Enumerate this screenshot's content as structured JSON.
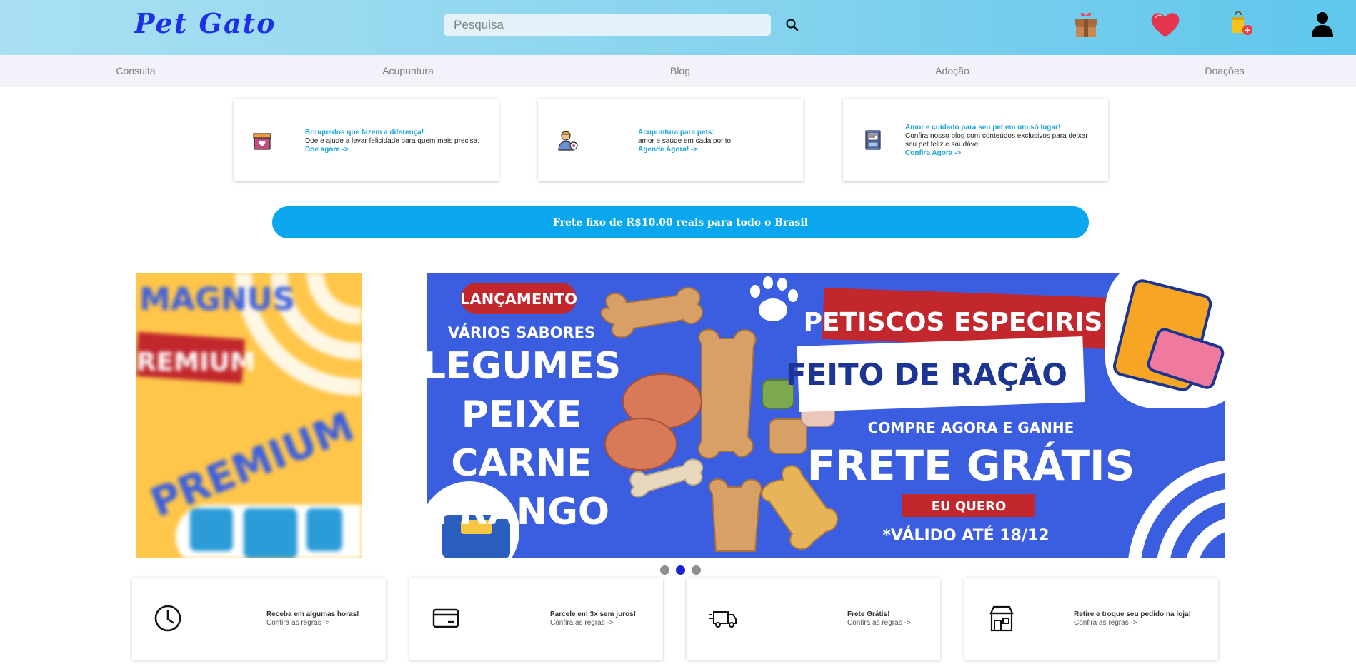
{
  "header": {
    "logo": "Pet Gato",
    "search": {
      "placeholder": "Pesquisa",
      "value": ""
    },
    "icons": [
      "search-icon",
      "gift-box-icon",
      "heart-icon",
      "shopping-bag-icon",
      "user-icon"
    ],
    "cart_badge": "+"
  },
  "nav": {
    "items": [
      {
        "label": "Consulta"
      },
      {
        "label": "Acupuntura"
      },
      {
        "label": "Blog"
      },
      {
        "label": "Adoção"
      },
      {
        "label": "Doações"
      }
    ]
  },
  "promos": [
    {
      "icon": "donation-box-icon",
      "title": "Brinquedos que fazem a diferença!",
      "text": "Doe e ajude a levar felicidade para quem mais precisa.",
      "link": "Doe agora ->"
    },
    {
      "icon": "vet-doctor-icon",
      "title": "Acupuntura para pets:",
      "text": "amor e saúde em cada ponto!",
      "link": "Agende Agora! ->"
    },
    {
      "icon": "blog-register-icon",
      "title": "Amor e cuidado para seu pet em um só lugar!",
      "text": "Confira nosso blog com conteúdos exclusivos para deixar seu pet feliz e saudável.",
      "link": "Confira Agora ->"
    }
  ],
  "shipping_banner": "Frete fixo de R$10.00 reais para todo o Brasil",
  "carousel": {
    "active_index": 1,
    "slide_count": 3,
    "prev_slide": {
      "brand": "MAGNUS",
      "tag": "REMIUM",
      "word": "PREMIUM"
    },
    "current_slide": {
      "badge": "LANÇAMENTO",
      "flavors_heading": "VÁRIOS SABORES",
      "flavors": [
        "LEGUMES",
        "PEIXE",
        "CARNE",
        "FRANGO"
      ],
      "title": "PETISCOS ESPECIRIS",
      "subtitle": "FEITO DE RAÇÃO",
      "offer_line": "COMPRE AGORA E GANHE",
      "offer": "FRETE GRÁTIS",
      "cta": "EU QUERO",
      "validity": "*VÁLIDO ATÉ 18/12"
    }
  },
  "features": [
    {
      "icon": "clock-icon",
      "title": "Receba em algumas horas!",
      "link": "Confira as regras ->"
    },
    {
      "icon": "credit-card-icon",
      "title": "Parcele em 3x sem juros!",
      "link": "Confira as regras ->"
    },
    {
      "icon": "delivery-truck-icon",
      "title": "Frete Grátis!",
      "link": "Confira as regras ->"
    },
    {
      "icon": "store-icon",
      "title": "Retire e troque seu pedido na loja!",
      "link": "Confira as regras ->"
    }
  ],
  "colors": {
    "accent": "#0aa7ee",
    "logo": "#1e2fe6",
    "link": "#1ea5dc",
    "nav_bg": "#f1f2fa",
    "active_dot": "#1a22d6",
    "banner_blue": "#3b5ee0",
    "banner_red": "#c1272d"
  }
}
